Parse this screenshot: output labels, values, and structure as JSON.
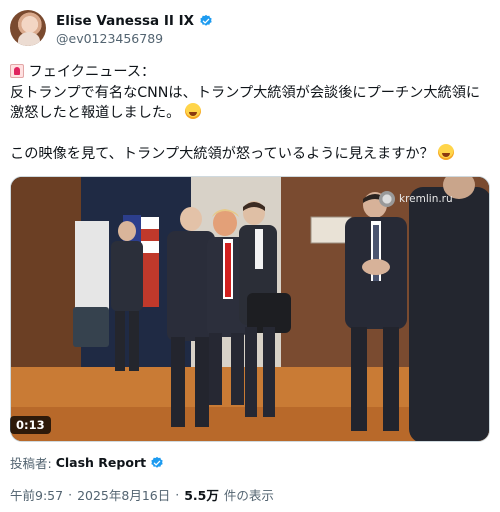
{
  "author": {
    "display_name": "Elise Vanessa II IX",
    "handle": "@ev0123456789"
  },
  "tweet": {
    "line1": "フェイクニュース：",
    "line2": "反トランプで有名なCNNは、トランプ大統領が会談後にプーチン大統領に",
    "line3": "激怒したと報道しました。",
    "line4": "この映像を見て、トランプ大統領が怒っているように見えますか？"
  },
  "media": {
    "duration": "0:13",
    "watermark": "kremlin.ru"
  },
  "attribution": {
    "label": "投稿者:",
    "name": "Clash Report"
  },
  "meta": {
    "time": "午前9:57",
    "separator": "·",
    "date": "2025年8月16日",
    "views": "5.5万",
    "views_suffix": "件の表示"
  },
  "colors": {
    "verified": "#1d9bf0",
    "text_primary": "#0f1419",
    "text_secondary": "#536471",
    "border": "#cfd9de"
  },
  "icons": {
    "emoji_start": "police-light-emoji",
    "emoji_rofl": "rofl-emoji",
    "verified": "verified-badge-icon"
  }
}
